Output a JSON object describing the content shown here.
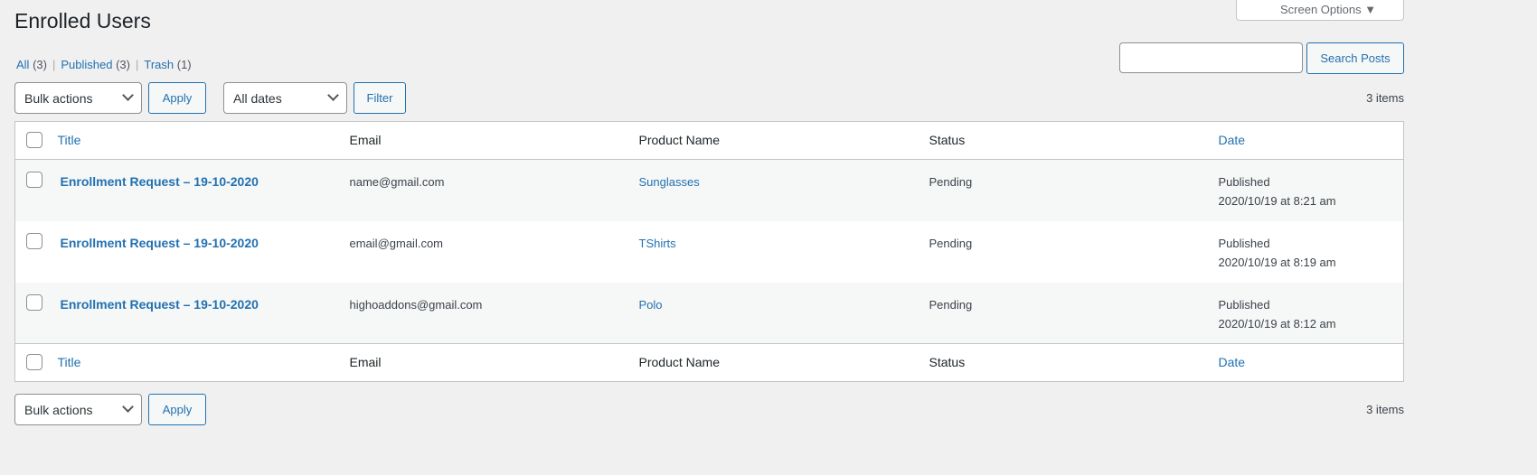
{
  "page_title": "Enrolled Users",
  "screen_options": "Screen Options ▼",
  "views": [
    {
      "label": "All",
      "count": "(3)"
    },
    {
      "label": "Published",
      "count": "(3)"
    },
    {
      "label": "Trash",
      "count": "(1)"
    }
  ],
  "search_button": "Search Posts",
  "search_value": "",
  "bulk_actions": "Bulk actions",
  "apply": "Apply",
  "dates": "All dates",
  "filter": "Filter",
  "items_count": "3 items",
  "columns": {
    "title": "Title",
    "email": "Email",
    "product": "Product Name",
    "status": "Status",
    "date": "Date"
  },
  "rows": [
    {
      "title": "Enrollment Request – 19-10-2020",
      "email": "name@gmail.com",
      "product": "Sunglasses",
      "status": "Pending",
      "date_status": "Published",
      "date": "2020/10/19 at 8:21 am"
    },
    {
      "title": "Enrollment Request – 19-10-2020",
      "email": "email@gmail.com",
      "product": "TShirts",
      "status": "Pending",
      "date_status": "Published",
      "date": "2020/10/19 at 8:19 am"
    },
    {
      "title": "Enrollment Request – 19-10-2020",
      "email": "highoaddons@gmail.com",
      "product": "Polo",
      "status": "Pending",
      "date_status": "Published",
      "date": "2020/10/19 at 8:12 am"
    }
  ]
}
